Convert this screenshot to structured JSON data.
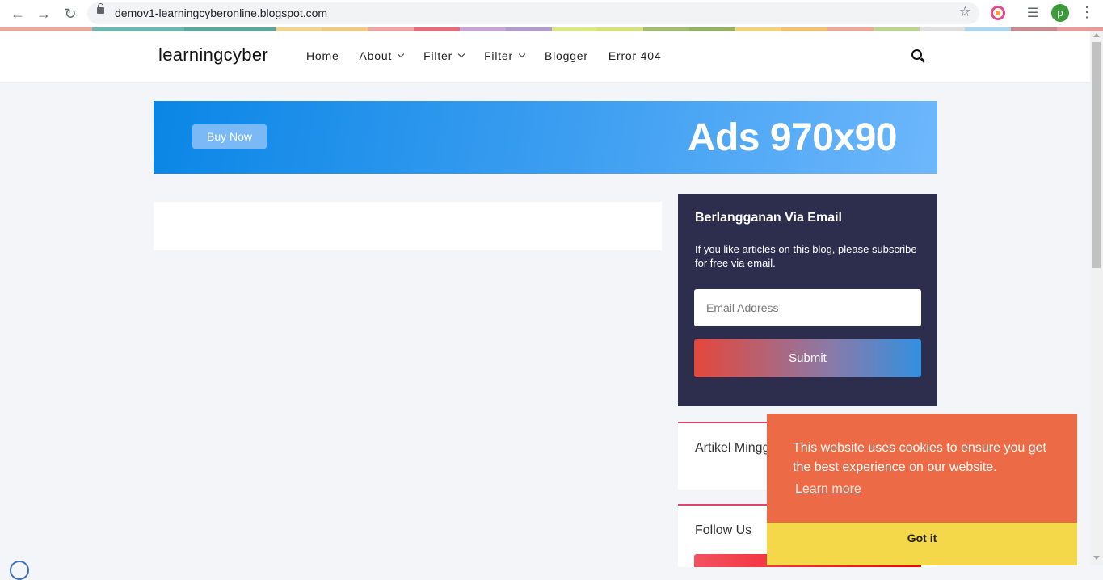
{
  "browser": {
    "url": "demov1-learningcyberonline.blogspot.com",
    "profile_initial": "p",
    "stripe_colors": [
      "#f0a79c",
      "#f0a79c",
      "#6cb8b4",
      "#6cb8b4",
      "#5aa7a0",
      "#5aa7a0",
      "#f2d48a",
      "#f2c87c",
      "#f2a4a0",
      "#e86b7a",
      "#c7a6d6",
      "#b59ad0",
      "#dce884",
      "#d8e077",
      "#9fbf6f",
      "#93b562",
      "#f5d37c",
      "#f5c070",
      "#f0a79c",
      "#b9d88e",
      "#e0e0e0",
      "#a8d8ef",
      "#c98b8b",
      "#e89b9b"
    ]
  },
  "header": {
    "logo": "learningcyber",
    "menu": [
      {
        "label": "Home",
        "has_dropdown": false
      },
      {
        "label": "About",
        "has_dropdown": true
      },
      {
        "label": "Filter",
        "has_dropdown": true
      },
      {
        "label": "Filter",
        "has_dropdown": true
      },
      {
        "label": "Blogger",
        "has_dropdown": false
      },
      {
        "label": "Error 404",
        "has_dropdown": false
      }
    ]
  },
  "ads": {
    "button": "Buy Now",
    "text": "Ads 970x90"
  },
  "subscribe": {
    "title": "Berlangganan Via Email",
    "description": "If you like articles on this blog, please subscribe for free via email.",
    "email_placeholder": "Email Address",
    "submit": "Submit"
  },
  "widgets": {
    "popular_title": "Artikel Minggu Ini",
    "follow_title": "Follow Us"
  },
  "cookie": {
    "message": "This website uses cookies to ensure you get the best experience on our website.",
    "learn_more": "Learn more",
    "accept": "Got it"
  }
}
